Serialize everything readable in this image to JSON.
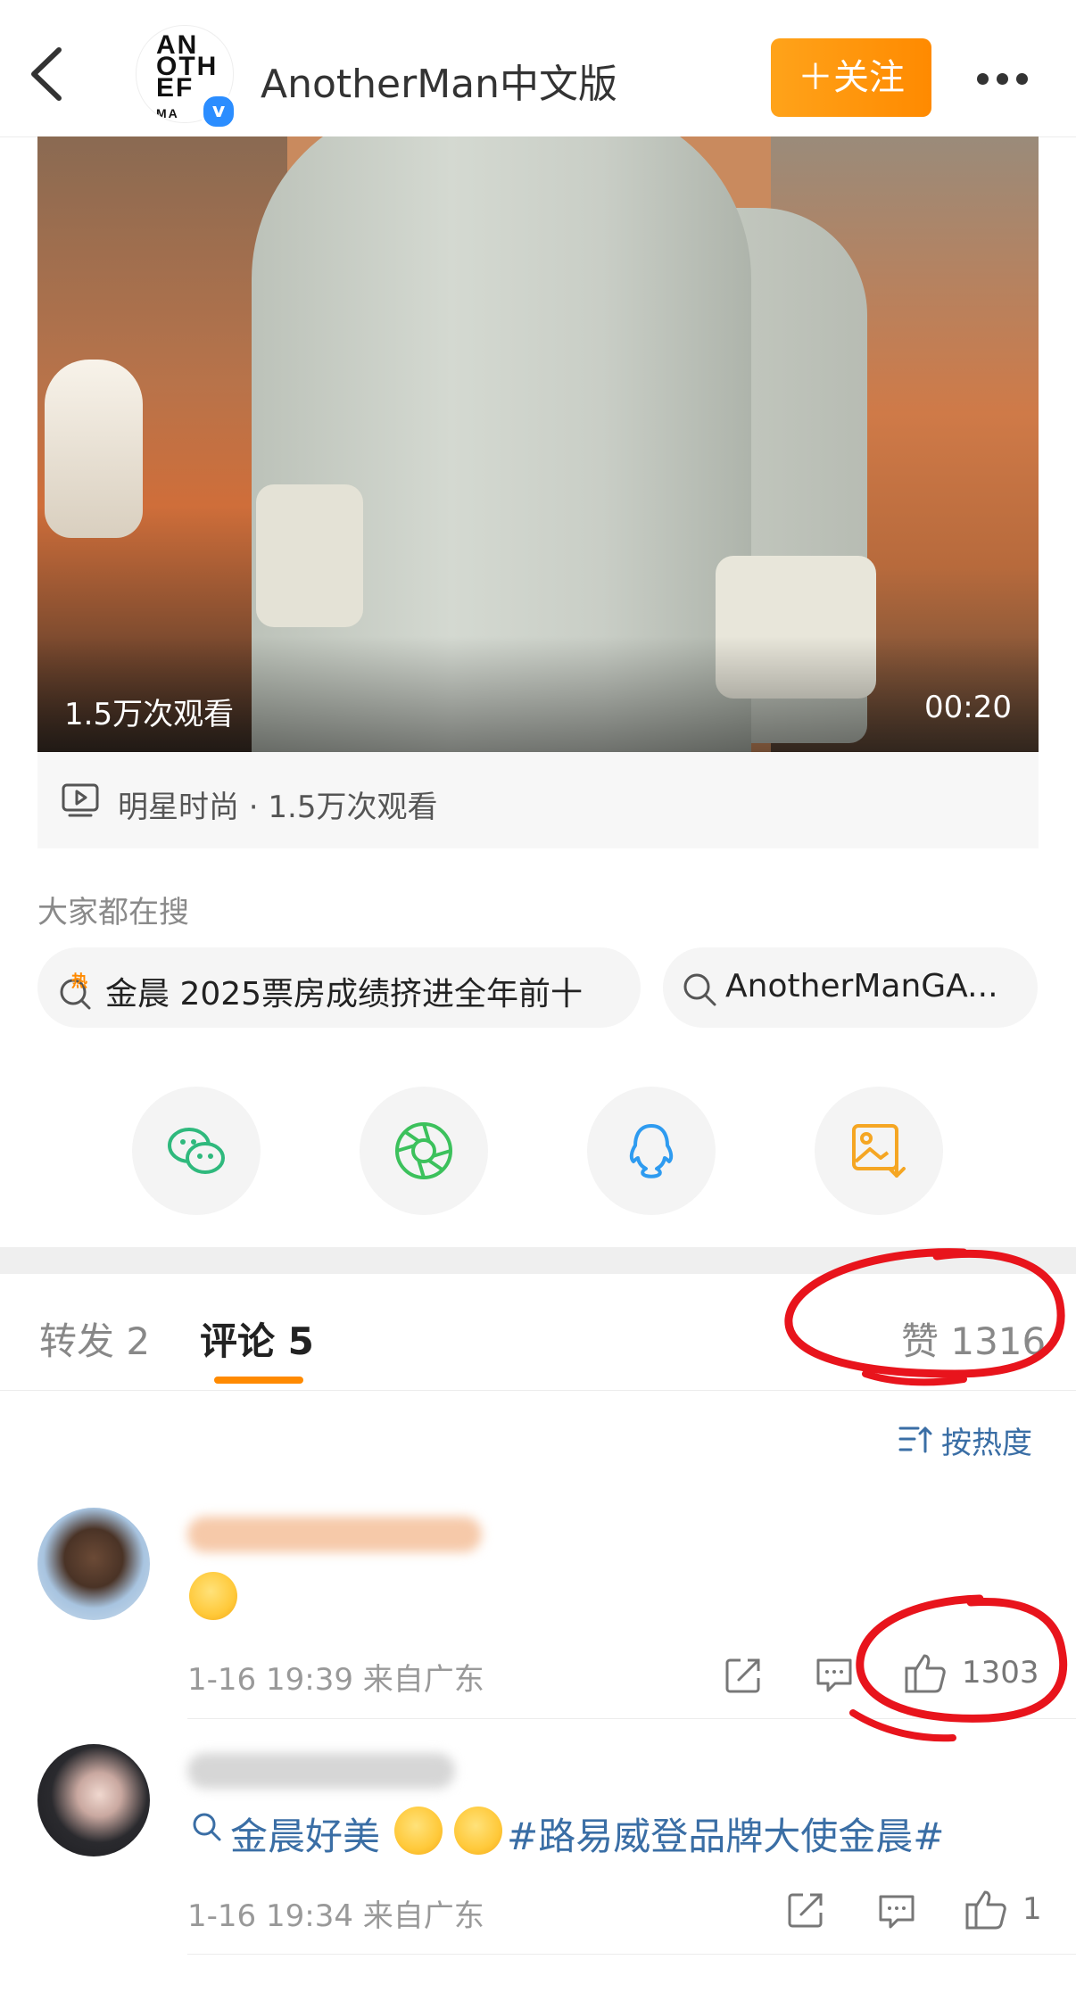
{
  "header": {
    "account_name": "AnotherMan中文版",
    "logo_text": "AN\nOTH\nEF\nMA",
    "follow_label": "＋关注"
  },
  "video": {
    "views_overlay": "1.5万次观看",
    "duration": "00:20",
    "info": "明星时尚 · 1.5万次观看"
  },
  "search": {
    "label": "大家都在搜",
    "suggestions": [
      {
        "text": "金晨 2025票房成绩挤进全年前十",
        "badge": "热"
      },
      {
        "text": "AnotherManGA..."
      }
    ]
  },
  "share": [
    "wechat-icon",
    "moments-icon",
    "qq-icon",
    "save-image-icon"
  ],
  "tabs": {
    "repost": "转发 2",
    "comments": "评论 5",
    "likes": "赞 1316"
  },
  "sort_label": "按热度",
  "comments": [
    {
      "meta": "1-16 19:39 来自广东",
      "like_count": "1303"
    },
    {
      "topic": "金晨好美",
      "hashtag": "#路易威登品牌大使金晨#",
      "meta": "1-16 19:34 来自广东",
      "like_count": "1"
    }
  ],
  "colors": {
    "accent": "#ff8a00",
    "link": "#3a6ea5",
    "annotation": "#e8141c"
  }
}
